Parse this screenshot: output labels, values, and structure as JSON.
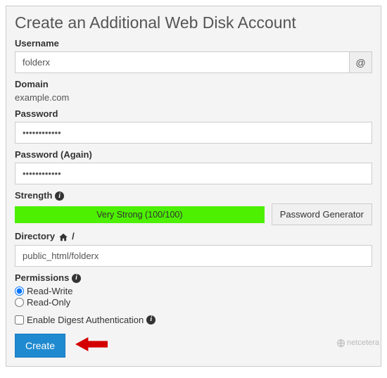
{
  "title": "Create an Additional Web Disk Account",
  "username": {
    "label": "Username",
    "value": "folderx",
    "addon": "@"
  },
  "domain": {
    "label": "Domain",
    "value": "example.com"
  },
  "password": {
    "label": "Password",
    "value": "••••••••••••"
  },
  "password2": {
    "label": "Password (Again)",
    "value": "••••••••••••"
  },
  "strength": {
    "label": "Strength",
    "text": "Very Strong (100/100)",
    "generator": "Password Generator"
  },
  "directory": {
    "label": "Directory",
    "sep": "/",
    "value": "public_html/folderx"
  },
  "permissions": {
    "label": "Permissions",
    "options": {
      "rw": "Read-Write",
      "ro": "Read-Only"
    }
  },
  "digest": {
    "label": "Enable Digest Authentication"
  },
  "create": "Create",
  "brand": "netcetera"
}
